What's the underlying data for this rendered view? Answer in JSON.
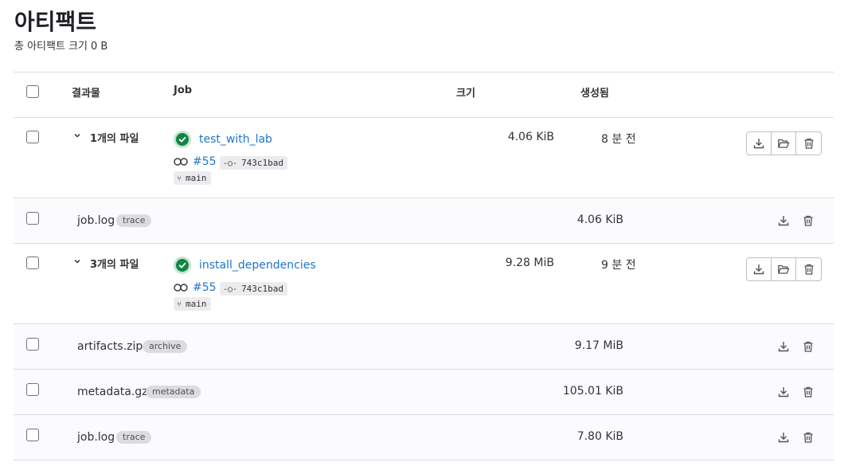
{
  "page": {
    "title": "아티팩트",
    "subtitle_label": "총 아티팩트 크기",
    "subtitle_size": "0 B"
  },
  "table": {
    "headers": {
      "artifacts": "결과물",
      "job": "Job",
      "size": "크기",
      "created": "생성됨"
    }
  },
  "jobs": [
    {
      "files_count": "1개의 파일",
      "job_name": "test_with_lab",
      "pipeline": "#55",
      "commit": "743c1bad",
      "branch": "main",
      "size": "4.06 KiB",
      "created": "8 분 전",
      "status": "success",
      "files": [
        {
          "name": "job.log",
          "type": "trace",
          "size": "4.06 KiB"
        }
      ]
    },
    {
      "files_count": "3개의 파일",
      "job_name": "install_dependencies",
      "pipeline": "#55",
      "commit": "743c1bad",
      "branch": "main",
      "size": "9.28 MiB",
      "created": "9 분 전",
      "status": "success",
      "files": [
        {
          "name": "artifacts.zip",
          "type": "archive",
          "size": "9.17 MiB"
        },
        {
          "name": "metadata.gz",
          "type": "metadata",
          "size": "105.01 KiB"
        },
        {
          "name": "job.log",
          "type": "trace",
          "size": "7.80 KiB"
        }
      ]
    }
  ],
  "colors": {
    "link": "#1f75cb",
    "success": "#108548",
    "border": "#dcdcde"
  },
  "icons": {
    "download": "download-icon",
    "browse": "folder-open-icon",
    "delete": "trash-icon",
    "expand": "chevron-down-icon",
    "pipeline": "pipeline-icon",
    "commit": "commit-icon",
    "branch": "branch-icon",
    "status": "status-success-icon"
  }
}
